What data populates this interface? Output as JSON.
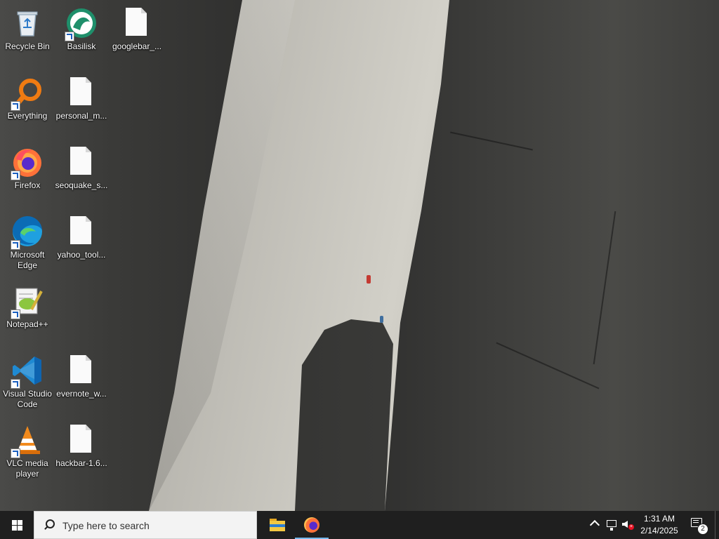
{
  "desktop": {
    "icons": [
      {
        "label": "Recycle Bin",
        "icon": "recycle-bin-icon",
        "shortcut": false
      },
      {
        "label": "Basilisk",
        "icon": "basilisk-icon",
        "shortcut": true
      },
      {
        "label": "googlebar_...",
        "icon": "file-icon",
        "shortcut": false
      },
      {
        "label": "Everything",
        "icon": "everything-search-icon",
        "shortcut": true
      },
      {
        "label": "personal_m...",
        "icon": "file-icon",
        "shortcut": false
      },
      {
        "label": "Firefox",
        "icon": "firefox-icon",
        "shortcut": true
      },
      {
        "label": "seoquake_s...",
        "icon": "file-icon",
        "shortcut": false
      },
      {
        "label": "Microsoft Edge",
        "icon": "edge-icon",
        "shortcut": true
      },
      {
        "label": "yahoo_tool...",
        "icon": "file-icon",
        "shortcut": false
      },
      {
        "label": "Notepad++",
        "icon": "notepad-plus-plus-icon",
        "shortcut": true
      },
      {
        "label": "Visual Studio Code",
        "icon": "vscode-icon",
        "shortcut": true
      },
      {
        "label": "evernote_w...",
        "icon": "file-icon",
        "shortcut": false
      },
      {
        "label": "VLC media player",
        "icon": "vlc-icon",
        "shortcut": true
      },
      {
        "label": "hackbar-1.6...",
        "icon": "file-icon",
        "shortcut": false
      }
    ]
  },
  "taskbar": {
    "search_placeholder": "Type here to search",
    "pinned": [
      {
        "name": "File Explorer",
        "icon": "file-explorer-icon"
      },
      {
        "name": "Firefox",
        "icon": "firefox-icon",
        "active": true
      }
    ],
    "tray": {
      "time": "1:31 AM",
      "date": "2/14/2025",
      "notification_count": "2"
    }
  },
  "colors": {
    "taskbar_bg": "#1f1f1f",
    "search_bg": "#f3f3f3",
    "accent": "#76b9ed"
  }
}
